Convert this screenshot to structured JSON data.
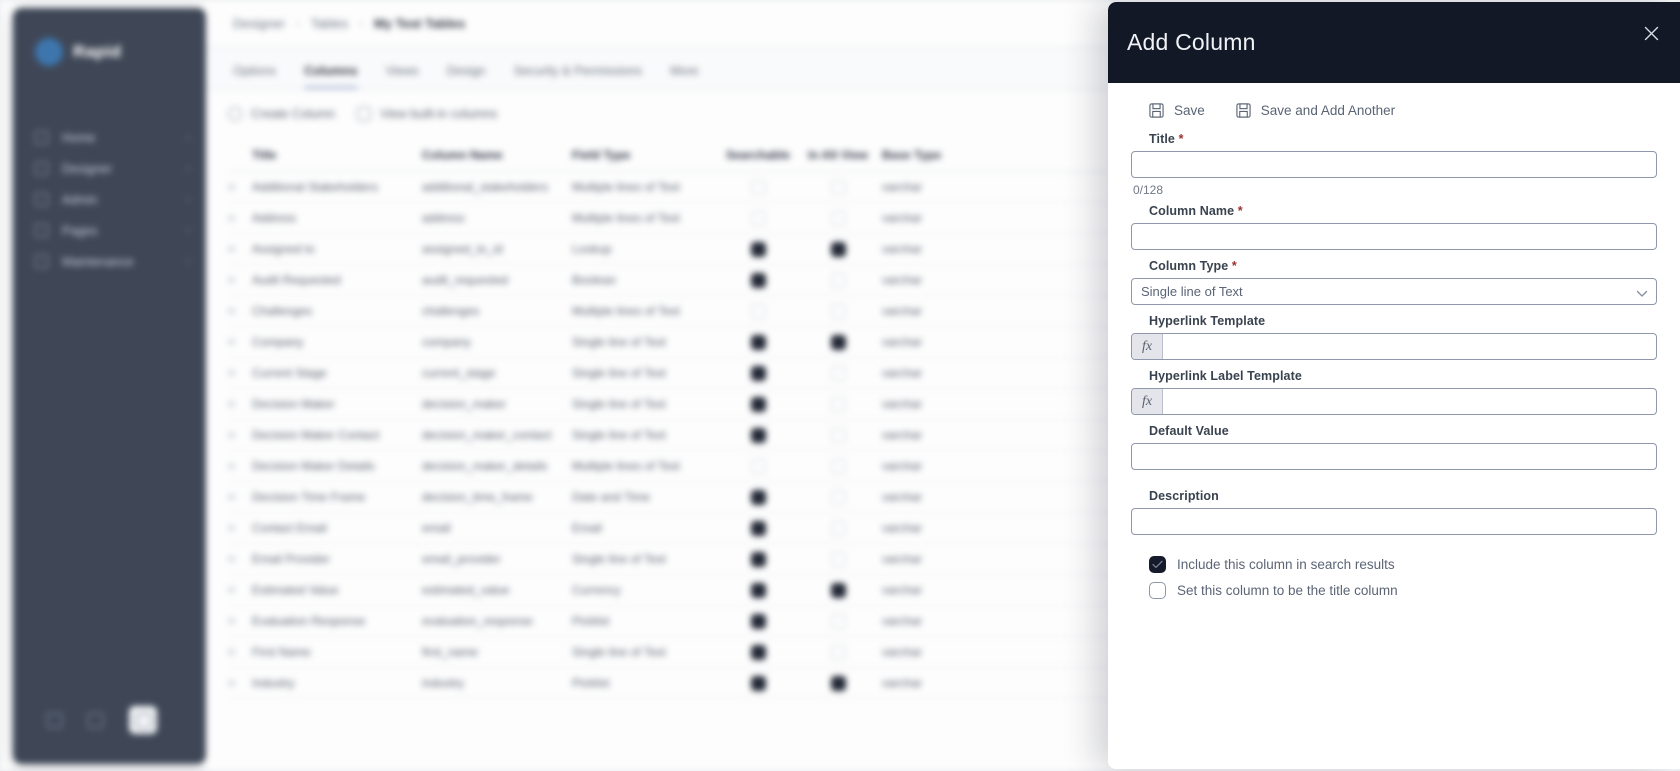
{
  "background": {
    "sidebar": {
      "brand": "Rapid",
      "logo_icon": "circle-logo-icon",
      "items": [
        {
          "label": "Home",
          "icon": "home-icon",
          "caret": "›"
        },
        {
          "label": "Designer",
          "icon": "wrench-icon",
          "caret": "›"
        },
        {
          "label": "Admin",
          "icon": "shield-icon",
          "caret": "›"
        },
        {
          "label": "Pages",
          "icon": "page-icon",
          "caret": "›"
        },
        {
          "label": "Maintenance",
          "icon": "tools-icon",
          "caret": "›"
        }
      ],
      "bottom_icons": [
        "user-icon",
        "link-icon",
        "settings-icon"
      ]
    },
    "breadcrumb": {
      "items": [
        "Designer",
        "Tables",
        "My Test Tables"
      ],
      "separator": "›"
    },
    "tabs": [
      {
        "label": "Options",
        "active": false
      },
      {
        "label": "Columns",
        "active": true
      },
      {
        "label": "Views",
        "active": false
      },
      {
        "label": "Design",
        "active": false
      },
      {
        "label": "Security & Permissions",
        "active": false
      },
      {
        "label": "More",
        "active": false
      }
    ],
    "actions": [
      {
        "label": "Create Column",
        "icon": "plus-circle-icon"
      },
      {
        "label": "View built-in columns",
        "icon": "eye-square-icon"
      }
    ],
    "table": {
      "columns": [
        "",
        "Title",
        "Column Name",
        "Field Type",
        "Searchable",
        "In Alt View",
        "Base Type"
      ],
      "rows": [
        {
          "title": "Additional Stakeholders",
          "name": "additional_stakeholders",
          "type": "Multiple lines of Text",
          "searchable": false,
          "alt_view": false,
          "base": "varchar"
        },
        {
          "title": "Address",
          "name": "address",
          "type": "Multiple lines of Text",
          "searchable": false,
          "alt_view": false,
          "base": "varchar"
        },
        {
          "title": "Assigned to",
          "name": "assigned_to_id",
          "type": "Lookup",
          "searchable": true,
          "alt_view": true,
          "base": "varchar"
        },
        {
          "title": "Audit Requested",
          "name": "audit_requested",
          "type": "Boolean",
          "searchable": true,
          "alt_view": false,
          "base": "varchar"
        },
        {
          "title": "Challenges",
          "name": "challenges",
          "type": "Multiple lines of Text",
          "searchable": false,
          "alt_view": false,
          "base": "varchar"
        },
        {
          "title": "Company",
          "name": "company",
          "type": "Single line of Text",
          "searchable": true,
          "alt_view": true,
          "base": "varchar"
        },
        {
          "title": "Current Stage",
          "name": "current_stage",
          "type": "Single line of Text",
          "searchable": true,
          "alt_view": false,
          "base": "varchar"
        },
        {
          "title": "Decision Maker",
          "name": "decision_maker",
          "type": "Single line of Text",
          "searchable": true,
          "alt_view": false,
          "base": "varchar"
        },
        {
          "title": "Decision Maker Contact",
          "name": "decision_maker_contact",
          "type": "Single line of Text",
          "searchable": true,
          "alt_view": false,
          "base": "varchar"
        },
        {
          "title": "Decision Maker Details",
          "name": "decision_maker_details",
          "type": "Multiple lines of Text",
          "searchable": false,
          "alt_view": false,
          "base": "varchar"
        },
        {
          "title": "Decision Time Frame",
          "name": "decision_time_frame",
          "type": "Date and Time",
          "searchable": true,
          "alt_view": false,
          "base": "varchar"
        },
        {
          "title": "Contact Email",
          "name": "email",
          "type": "Email",
          "searchable": true,
          "alt_view": false,
          "base": "varchar"
        },
        {
          "title": "Email Provider",
          "name": "email_provider",
          "type": "Single line of Text",
          "searchable": true,
          "alt_view": false,
          "base": "varchar"
        },
        {
          "title": "Estimated Value",
          "name": "estimated_value",
          "type": "Currency",
          "searchable": true,
          "alt_view": true,
          "base": "varchar"
        },
        {
          "title": "Evaluation Response",
          "name": "evaluation_response",
          "type": "Picklist",
          "searchable": true,
          "alt_view": false,
          "base": "varchar"
        },
        {
          "title": "First Name",
          "name": "first_name",
          "type": "Single line of Text",
          "searchable": true,
          "alt_view": false,
          "base": "varchar"
        },
        {
          "title": "Industry",
          "name": "industry",
          "type": "Picklist",
          "searchable": true,
          "alt_view": true,
          "base": "varchar"
        }
      ]
    }
  },
  "panel": {
    "title": "Add Column",
    "close_icon": "close-icon",
    "toolbar": {
      "save_label": "Save",
      "save_icon": "save-disk-icon",
      "save_add_another_label": "Save and Add Another",
      "save_add_another_icon": "save-disk-icon"
    },
    "fields": {
      "title": {
        "label": "Title",
        "required_marker": "*",
        "value": "",
        "placeholder": "",
        "counter": "0/128"
      },
      "column_name": {
        "label": "Column Name",
        "required_marker": "*",
        "value": "",
        "placeholder": ""
      },
      "column_type": {
        "label": "Column Type",
        "required_marker": "*",
        "selected": "Single line of Text",
        "caret_icon": "chevron-down-icon"
      },
      "hyperlink_template": {
        "label": "Hyperlink Template",
        "fx_label": "fx",
        "fx_icon": "formula-fx-icon",
        "value": "",
        "placeholder": ""
      },
      "hyperlink_label_template": {
        "label": "Hyperlink Label Template",
        "fx_label": "fx",
        "fx_icon": "formula-fx-icon",
        "value": "",
        "placeholder": ""
      },
      "default_value": {
        "label": "Default Value",
        "value": "",
        "placeholder": ""
      },
      "description": {
        "label": "Description",
        "value": "",
        "placeholder": ""
      }
    },
    "checkboxes": [
      {
        "label": "Include this column in search results",
        "checked": true,
        "icon": "check-icon"
      },
      {
        "label": "Set this column to be the title column",
        "checked": false,
        "icon": "check-icon"
      }
    ]
  },
  "colors": {
    "panel_header_bg": "#121826",
    "checkbox_checked_bg": "#151b2b",
    "required_asterisk": "#9e2f2f",
    "input_border": "#8f98ab",
    "sidebar_bg": "#313a4b",
    "fx_button_bg": "#e3e5ea"
  }
}
